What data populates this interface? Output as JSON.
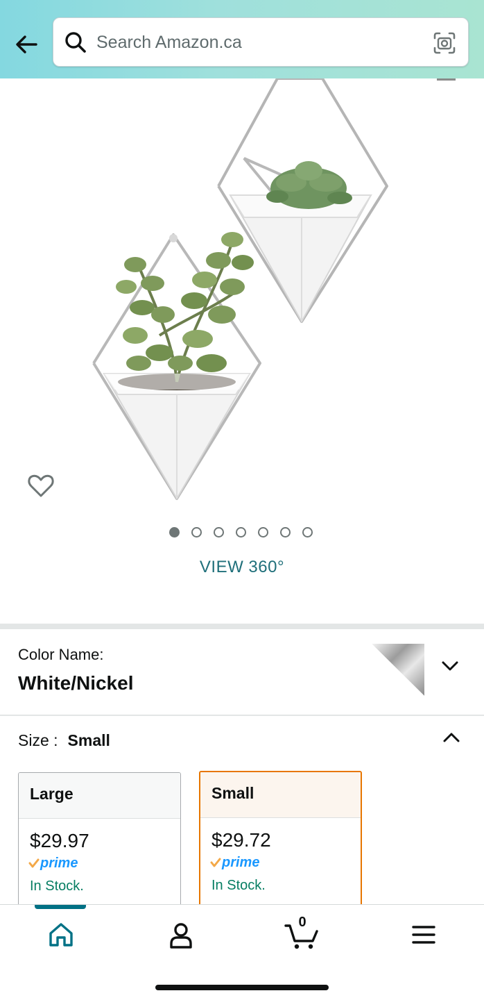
{
  "header": {
    "search_placeholder": "Search Amazon.ca"
  },
  "gallery": {
    "image_count": 7,
    "active_index": 0,
    "view360_label": "VIEW 360°"
  },
  "color": {
    "label": "Color Name:",
    "value": "White/Nickel"
  },
  "size": {
    "label": "Size :",
    "value": "Small",
    "options": [
      {
        "name": "Large",
        "price": "$29.97",
        "prime": "prime",
        "stock": "In Stock."
      },
      {
        "name": "Small",
        "price": "$29.72",
        "prime": "prime",
        "stock": "In Stock."
      }
    ]
  },
  "nav": {
    "cart_count": "0",
    "items": [
      "home-icon",
      "account-icon",
      "cart-icon",
      "menu-icon"
    ]
  },
  "colors": {
    "header_gradient_start": "#84d8e0",
    "header_gradient_end": "#a9e4d2",
    "teal_link": "#1f6f7a",
    "selected_border": "#e77600",
    "prime_blue": "#1a98ff",
    "in_stock_green": "#067d62"
  }
}
